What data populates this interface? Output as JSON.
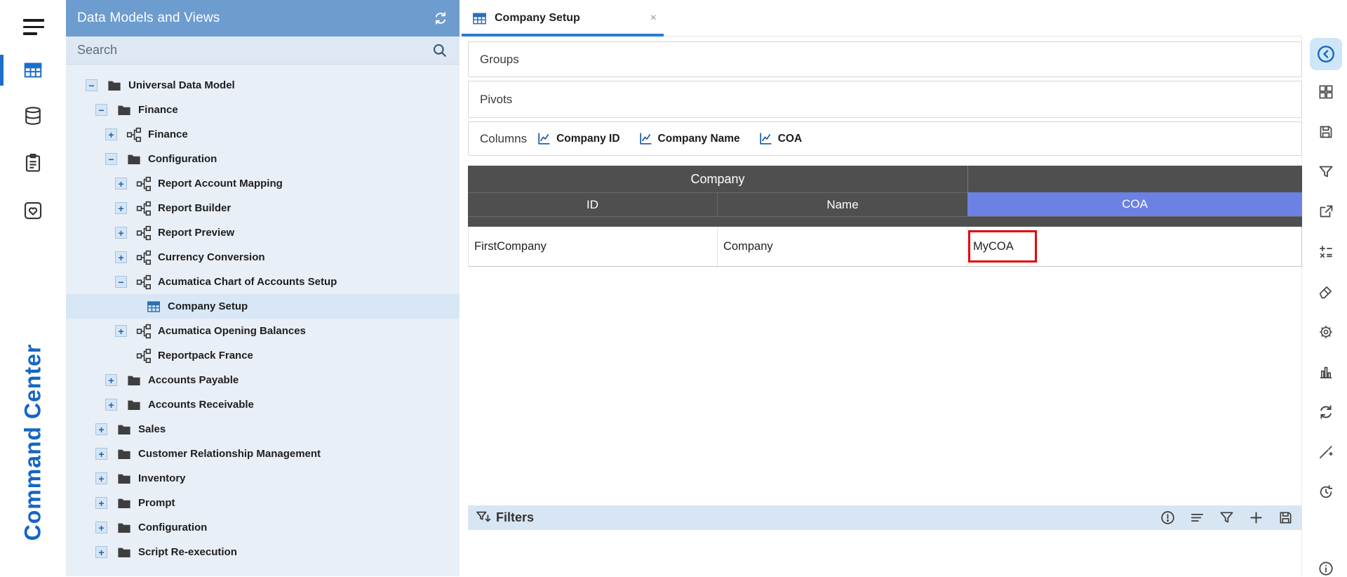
{
  "left_rail": {
    "command_center": "Command Center",
    "nav": [
      {
        "name": "data-models",
        "icon": "table-filled",
        "active": true
      },
      {
        "name": "database",
        "icon": "database",
        "active": false
      },
      {
        "name": "scripts",
        "icon": "clipboard",
        "active": false
      },
      {
        "name": "favorites",
        "icon": "heart-box",
        "active": false
      }
    ]
  },
  "sidebar": {
    "title": "Data Models and Views",
    "search_placeholder": "Search",
    "expander_glyphs": {
      "plus": "+",
      "minus": "−"
    },
    "tree": [
      {
        "label": "Universal Data Model",
        "level": 0,
        "type": "folder",
        "expander": "minus"
      },
      {
        "label": "Finance",
        "level": 1,
        "type": "folder",
        "expander": "minus"
      },
      {
        "label": "Finance",
        "level": 2,
        "type": "model",
        "expander": "plus"
      },
      {
        "label": "Configuration",
        "level": 2,
        "type": "folder",
        "expander": "minus"
      },
      {
        "label": "Report Account Mapping",
        "level": 3,
        "type": "model",
        "expander": "plus"
      },
      {
        "label": "Report Builder",
        "level": 3,
        "type": "model",
        "expander": "plus"
      },
      {
        "label": "Report Preview",
        "level": 3,
        "type": "model",
        "expander": "plus"
      },
      {
        "label": "Currency Conversion",
        "level": 3,
        "type": "model",
        "expander": "plus"
      },
      {
        "label": "Acumatica Chart of Accounts Setup",
        "level": 3,
        "type": "model",
        "expander": "minus"
      },
      {
        "label": "Company Setup",
        "level": 4,
        "type": "view",
        "expander": "none",
        "selected": true
      },
      {
        "label": "Acumatica Opening Balances",
        "level": 3,
        "type": "model",
        "expander": "plus"
      },
      {
        "label": "Reportpack France",
        "level": 3,
        "type": "model",
        "expander": "none"
      },
      {
        "label": "Accounts Payable",
        "level": 2,
        "type": "folder",
        "expander": "plus"
      },
      {
        "label": "Accounts Receivable",
        "level": 2,
        "type": "folder",
        "expander": "plus"
      },
      {
        "label": "Sales",
        "level": 1,
        "type": "folder",
        "expander": "plus"
      },
      {
        "label": "Customer Relationship Management",
        "level": 1,
        "type": "folder",
        "expander": "plus"
      },
      {
        "label": "Inventory",
        "level": 1,
        "type": "folder",
        "expander": "plus"
      },
      {
        "label": "Prompt",
        "level": 1,
        "type": "folder",
        "expander": "plus"
      },
      {
        "label": "Configuration",
        "level": 1,
        "type": "folder",
        "expander": "plus"
      },
      {
        "label": "Script Re-execution",
        "level": 1,
        "type": "folder",
        "expander": "plus"
      }
    ]
  },
  "main": {
    "tab": {
      "title": "Company Setup",
      "close_glyph": "×"
    },
    "panels": {
      "groups": "Groups",
      "pivots": "Pivots",
      "columns": "Columns"
    },
    "column_chips": [
      "Company ID",
      "Company Name",
      "COA"
    ],
    "table": {
      "group_header": "Company",
      "columns": [
        "ID",
        "Name",
        "COA"
      ],
      "rows": [
        [
          "FirstCompany",
          "Company",
          "MyCOA"
        ]
      ],
      "highlighted_cell": {
        "row": 0,
        "column": "COA",
        "value": "MyCOA"
      }
    },
    "filters": {
      "label": "Filters",
      "icons_right": [
        "alert",
        "list",
        "funnel",
        "plus",
        "save"
      ]
    }
  },
  "right_rail": {
    "collapse_icon": "chevron-left",
    "tools": [
      "dashboard",
      "save",
      "funnel",
      "export",
      "operations",
      "eraser",
      "gear",
      "bar-chart",
      "refresh",
      "wand",
      "history"
    ],
    "bottom_icon": "info"
  },
  "colors": {
    "accent_blue": "#1B6FC9",
    "sidebar_header_blue": "#6D9CCF",
    "table_header_gray": "#4F4F4F",
    "coa_header_blue": "#6B81E4",
    "highlight_red": "#E00505",
    "selected_row_bg": "#D8E7F6",
    "filters_bar_bg": "#D8E6F4"
  }
}
